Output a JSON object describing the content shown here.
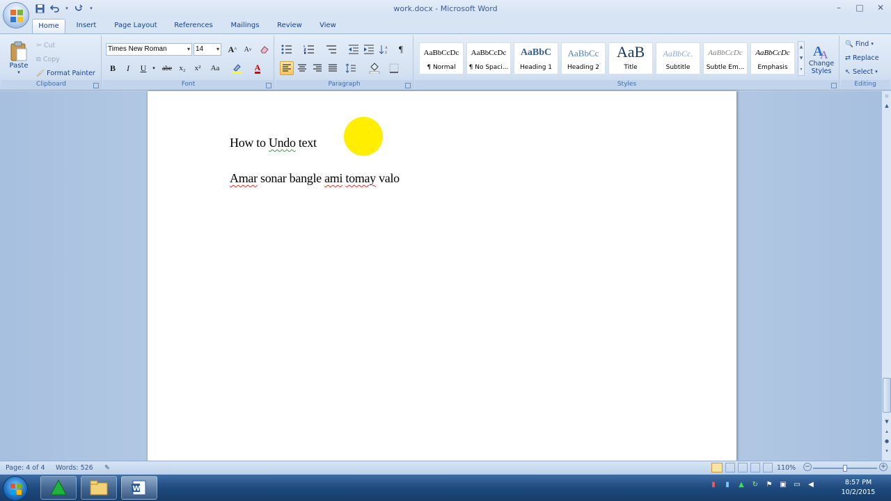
{
  "window": {
    "title": "work.docx - Microsoft Word",
    "controls": [
      "–",
      "□",
      "✕"
    ]
  },
  "quick_access": {
    "save_icon": "save-icon",
    "undo_icon": "undo-icon",
    "redo_icon": "redo-icon"
  },
  "tabs": [
    {
      "label": "Home",
      "active": true
    },
    {
      "label": "Insert"
    },
    {
      "label": "Page Layout"
    },
    {
      "label": "References"
    },
    {
      "label": "Mailings"
    },
    {
      "label": "Review"
    },
    {
      "label": "View"
    }
  ],
  "ribbon": {
    "clipboard": {
      "label": "Clipboard",
      "paste": "Paste",
      "cut": "Cut",
      "copy": "Copy",
      "format_painter": "Format Painter"
    },
    "font": {
      "label": "Font",
      "font_name": "Times New Roman",
      "font_size": "14",
      "bold": "B",
      "italic": "I",
      "underline": "U",
      "strikethrough": "abe",
      "subscript": "x₂",
      "superscript": "x²",
      "change_case": "Aa",
      "grow": "A",
      "shrink": "A",
      "font_color": "A"
    },
    "paragraph": {
      "label": "Paragraph",
      "show_marks": "¶"
    },
    "styles": {
      "label": "Styles",
      "items": [
        {
          "sample": "AaBbCcDc",
          "name": "¶ Normal"
        },
        {
          "sample": "AaBbCcDc",
          "name": "¶ No Spaci..."
        },
        {
          "sample": "AaBbC",
          "name": "Heading 1"
        },
        {
          "sample": "AaBbCc",
          "name": "Heading 2"
        },
        {
          "sample": "AaB",
          "name": "Title"
        },
        {
          "sample": "AaBbCc.",
          "name": "Subtitle"
        },
        {
          "sample": "AaBbCcDc",
          "name": "Subtle Em..."
        },
        {
          "sample": "AaBbCcDc",
          "name": "Emphasis"
        }
      ],
      "change_styles": "Change Styles"
    },
    "editing": {
      "label": "Editing",
      "find": "Find",
      "replace": "Replace",
      "select": "Select"
    }
  },
  "document": {
    "lines": [
      {
        "words": [
          {
            "text": "How to "
          },
          {
            "text": "Undo",
            "mark": "green"
          },
          {
            "text": " text"
          }
        ]
      },
      {
        "words": [
          {
            "text": "Amar",
            "mark": "red"
          },
          {
            "text": " sonar bangle "
          },
          {
            "text": "ami",
            "mark": "red"
          },
          {
            "text": " "
          },
          {
            "text": "tomay",
            "mark": "red"
          },
          {
            "text": " valo"
          }
        ]
      }
    ]
  },
  "status": {
    "page": "Page: 4 of 4",
    "words": "Words: 526",
    "zoom": "110%"
  },
  "taskbar": {
    "time": "8:57 PM",
    "date": "10/2/2015"
  },
  "colors": {
    "highlight": "#ffee00",
    "ribbon_bg": "#d3e1f2",
    "taskbar": "#1f4a7e"
  }
}
